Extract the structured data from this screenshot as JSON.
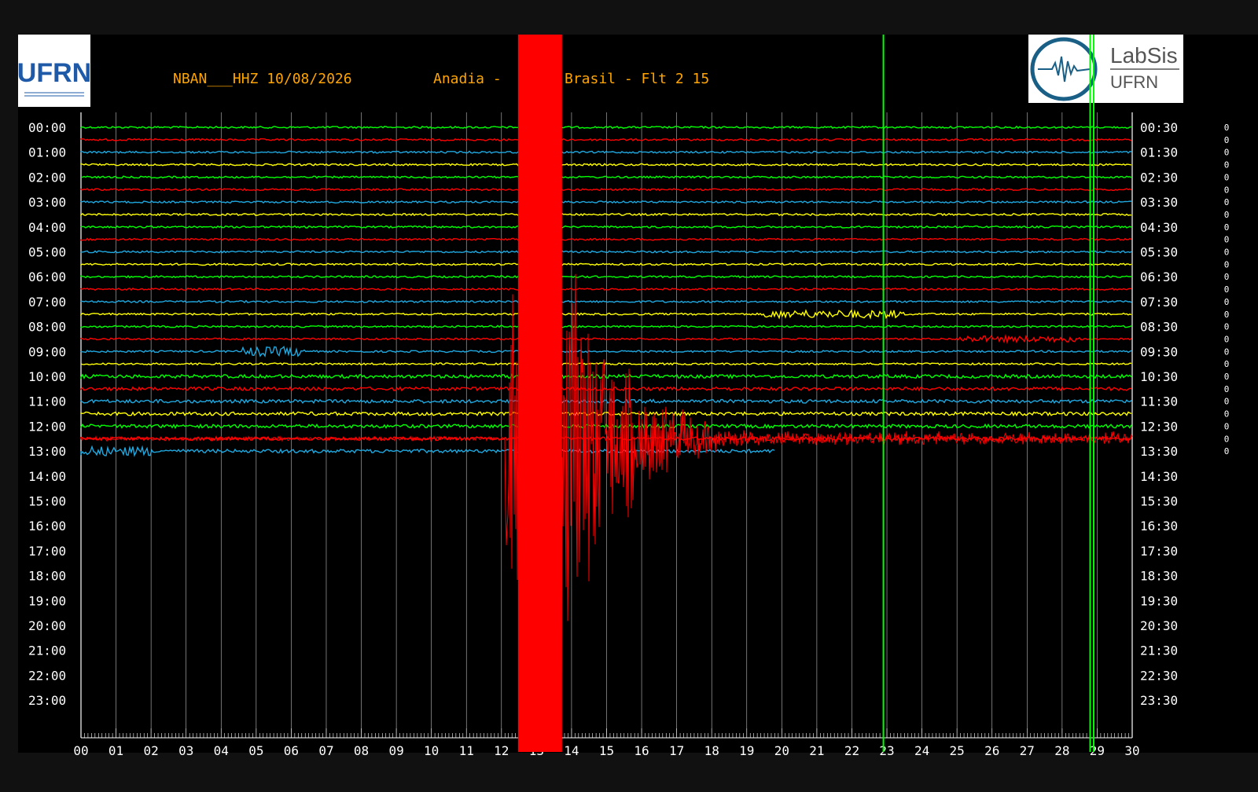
{
  "header": {
    "station": "NBAN___HHZ 10/08/2026",
    "location": "Anadia - ",
    "location2": "Brasil - Flt 2 15"
  },
  "logos": {
    "left": "UFRN",
    "right_top": "LabSis",
    "right_bottom": "UFRN"
  },
  "colors": {
    "background": "#000000",
    "header_text": "#ffa500",
    "axis_text": "#ffffff",
    "trace_cycle": [
      "#00ff00",
      "#ff0000",
      "#1fa8e0",
      "#ffff00"
    ],
    "event_trace": "#ff0000",
    "grid": "#ffffff",
    "glitch_lines": "#00ff00"
  },
  "chart_data": {
    "type": "helicorder",
    "xlabel": "",
    "ylabel": "",
    "x_ticks": [
      "00",
      "01",
      "02",
      "03",
      "04",
      "05",
      "06",
      "07",
      "08",
      "09",
      "10",
      "11",
      "12",
      "13",
      "14",
      "15",
      "16",
      "17",
      "18",
      "19",
      "20",
      "21",
      "22",
      "23",
      "24",
      "25",
      "26",
      "27",
      "28",
      "29",
      "30"
    ],
    "x_range_minutes": [
      0,
      30
    ],
    "left_labels": [
      "00:00",
      "01:00",
      "02:00",
      "03:00",
      "04:00",
      "05:00",
      "06:00",
      "07:00",
      "08:00",
      "09:00",
      "10:00",
      "11:00",
      "12:00",
      "13:00",
      "14:00",
      "15:00",
      "16:00",
      "17:00",
      "18:00",
      "19:00",
      "20:00",
      "21:00",
      "22:00",
      "23:00"
    ],
    "right_labels": [
      "00:30",
      "01:30",
      "02:30",
      "03:30",
      "04:30",
      "05:30",
      "06:30",
      "07:30",
      "08:30",
      "09:30",
      "10:30",
      "11:30",
      "12:30",
      "13:30",
      "14:30",
      "15:30",
      "16:30",
      "17:30",
      "18:30",
      "19:30",
      "20:30",
      "21:30",
      "22:30",
      "23:30"
    ],
    "right_markers_count": 27,
    "right_marker_char": "0",
    "traces_recorded": 27,
    "last_trace_end_minute": 19.8,
    "event": {
      "trace_index": 25,
      "onset_minute": 12.1,
      "peak_minute": 13.1,
      "approx_end_minute": 30
    },
    "glitch_lines_minutes": [
      22.9,
      28.8,
      28.9
    ]
  }
}
